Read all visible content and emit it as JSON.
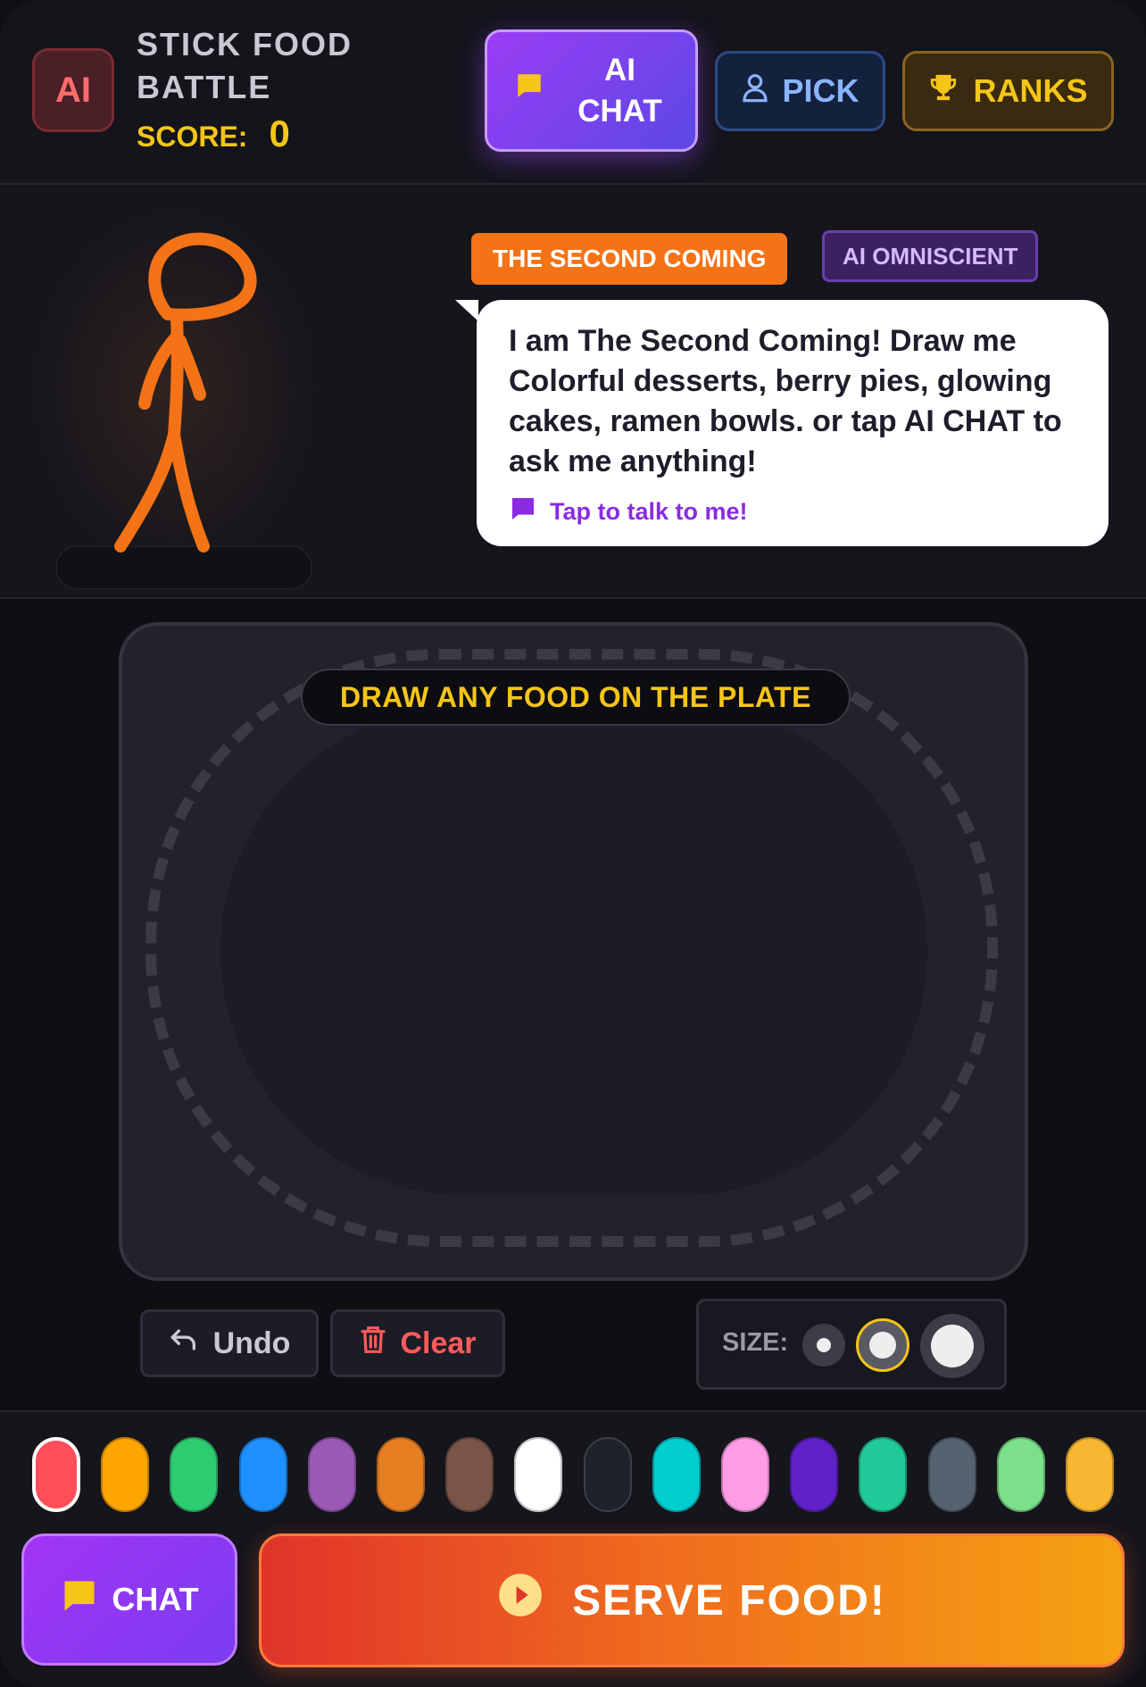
{
  "header": {
    "badge": "AI",
    "title": "STICK FOOD BATTLE",
    "score_label": "SCORE:",
    "score_value": "0",
    "ai_chat_label": "AI CHAT",
    "pick_label": "PICK",
    "ranks_label": "RANKS"
  },
  "character": {
    "name_tag": "THE SECOND COMING",
    "mode_tag": "AI OMNISCIENT",
    "color": "#f47316",
    "speech": "I am The Second Coming! Draw me Colorful desserts, berry pies, glowing cakes, ramen bowls. or tap AI CHAT to ask me anything!",
    "cta": "Tap to talk to me!"
  },
  "canvas": {
    "instruction": "DRAW ANY FOOD ON THE PLATE"
  },
  "tools": {
    "undo_label": "Undo",
    "clear_label": "Clear",
    "size_label": "SIZE:",
    "brush_sizes": [
      "small",
      "medium",
      "large"
    ],
    "selected_size": "medium"
  },
  "palette": {
    "colors": [
      "#ff4d5a",
      "#ffa500",
      "#2ecc71",
      "#1e90ff",
      "#9b59b6",
      "#e67e22",
      "#795548",
      "#ffffff",
      "#1e222a",
      "#00ced1",
      "#ff9ce6",
      "#6022c8",
      "#20c997",
      "#556270",
      "#7ce08a",
      "#f7b731"
    ],
    "selected_index": 0
  },
  "footer": {
    "chat_label": "CHAT",
    "serve_label": "SERVE FOOD!"
  }
}
